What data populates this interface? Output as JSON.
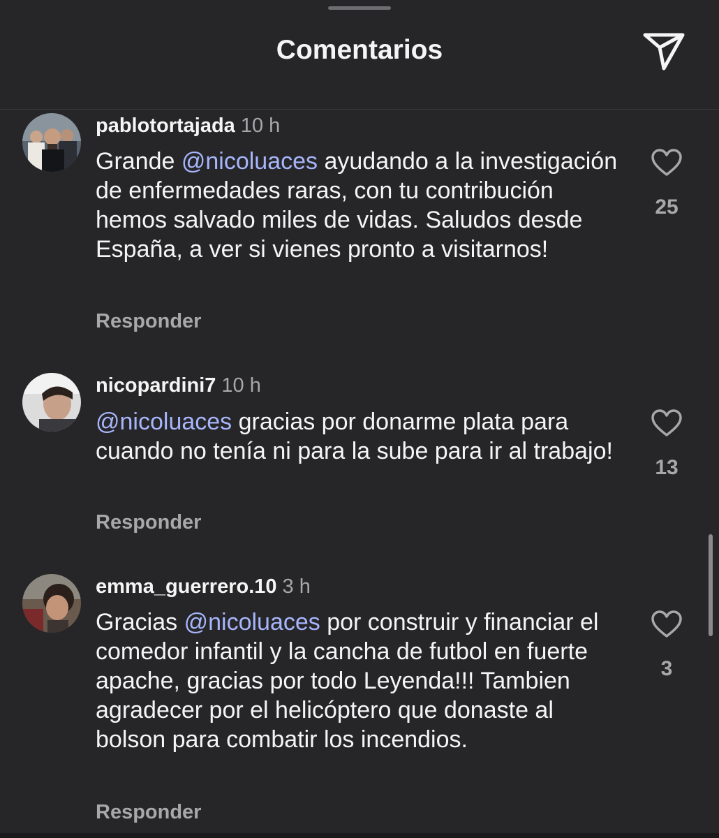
{
  "header": {
    "title": "Comentarios",
    "share_icon": "paper-plane-icon"
  },
  "comments": [
    {
      "username": "pablotortajada",
      "time": "10 h",
      "text_before": "Grande ",
      "mention": "@nicoluaces",
      "text_after": " ayudando a la investigación de enfermedades raras, con tu contribución hemos salvado miles de vidas. Saludos desde España, a ver si vienes pronto a visitarnos!",
      "likes": "25",
      "reply_label": "Responder"
    },
    {
      "username": "nicopardini7",
      "time": "10 h",
      "text_before": "",
      "mention": "@nicoluaces",
      "text_after": " gracias por donarme plata para cuando no tenía ni para la sube para ir al trabajo!",
      "likes": "13",
      "reply_label": "Responder"
    },
    {
      "username": "emma_guerrero.10",
      "time": "3 h",
      "text_before": "Gracias ",
      "mention": "@nicoluaces",
      "text_after": " por construir y financiar el comedor infantil y la cancha de futbol en fuerte apache, gracias por todo Leyenda!!! Tambien agradecer por el helicóptero que donaste al bolson para combatir los incendios.",
      "likes": "3",
      "reply_label": "Responder"
    }
  ],
  "colors": {
    "background": "#262628",
    "mention": "#a7b5fb",
    "secondary_text": "#a8a8ab"
  }
}
